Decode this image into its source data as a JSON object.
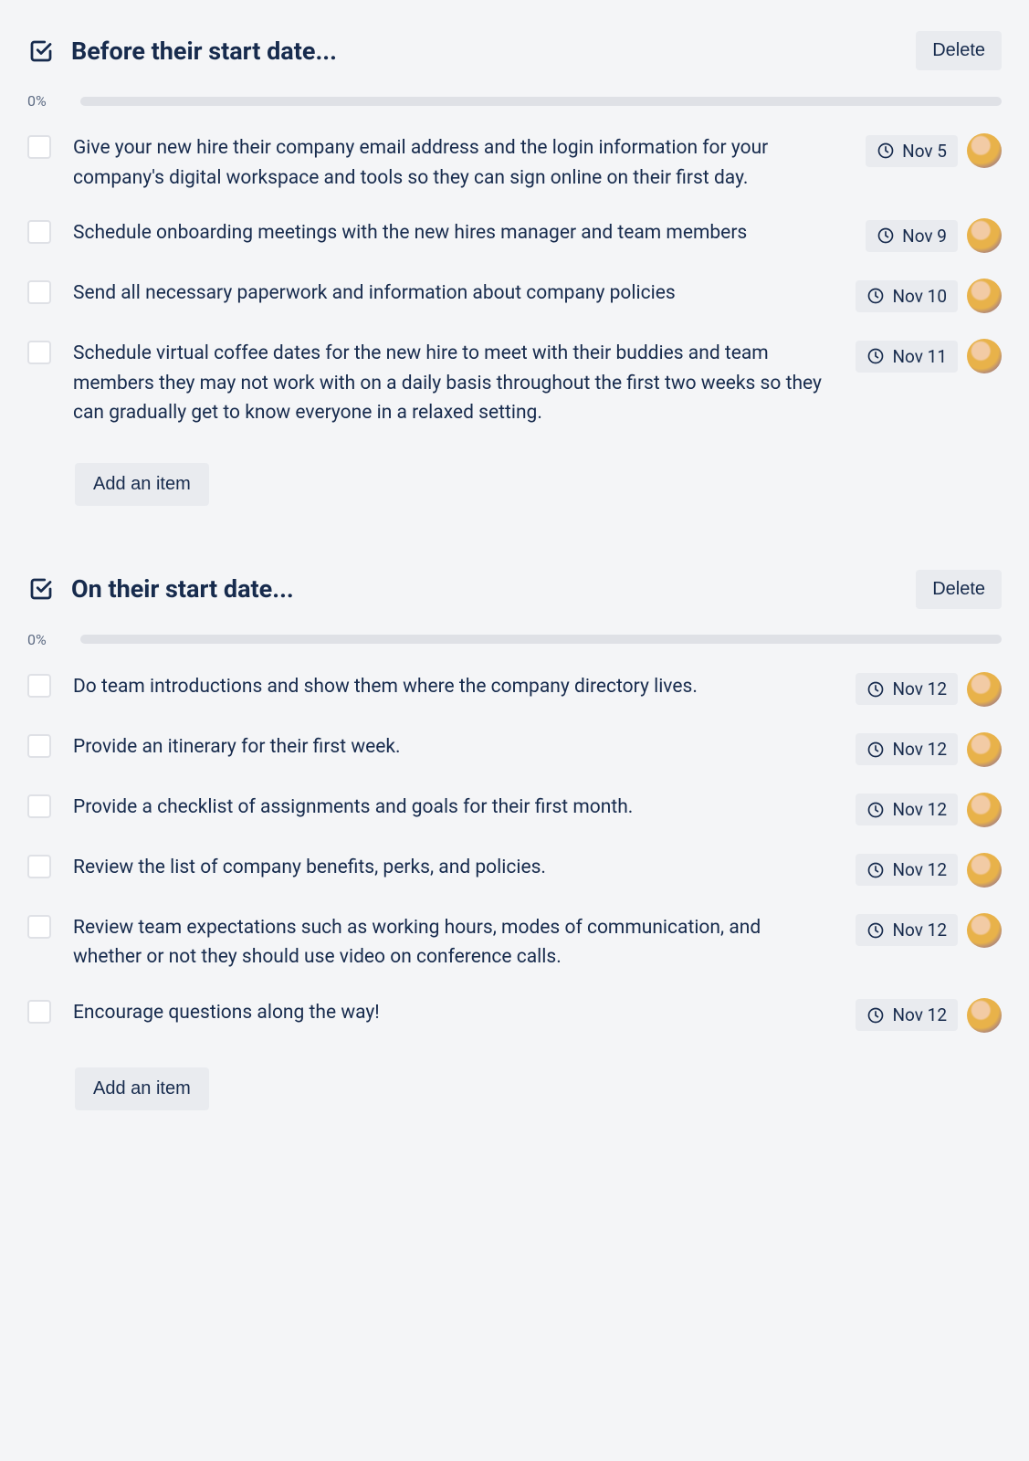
{
  "sections": [
    {
      "title": "Before their start date...",
      "delete_label": "Delete",
      "progress_pct": "0%",
      "add_item_label": "Add an item",
      "items": [
        {
          "text": "Give your new hire their company email address and the login information for your company's digital workspace and tools so they can sign online on their first day.",
          "date": "Nov 5"
        },
        {
          "text": "Schedule onboarding meetings with the new hires manager and team members",
          "date": "Nov 9"
        },
        {
          "text": "Send all necessary paperwork and information about company policies",
          "date": "Nov 10"
        },
        {
          "text": "Schedule virtual coffee dates for the new hire to meet with their buddies and team members they may not work with on a daily basis throughout the first two weeks so they can gradually get to know everyone in a relaxed setting.",
          "date": "Nov 11"
        }
      ]
    },
    {
      "title": "On their start date...",
      "delete_label": "Delete",
      "progress_pct": "0%",
      "add_item_label": "Add an item",
      "items": [
        {
          "text": "Do team introductions and show them where the company directory lives.",
          "date": "Nov 12"
        },
        {
          "text": "Provide an itinerary for their first week.",
          "date": "Nov 12"
        },
        {
          "text": "Provide a checklist of assignments and goals for their first month.",
          "date": "Nov 12"
        },
        {
          "text": "Review the list of company benefits, perks, and policies.",
          "date": "Nov 12"
        },
        {
          "text": "Review team expectations such as working hours, modes of communication, and whether or not they should use video on conference calls.",
          "date": "Nov 12"
        },
        {
          "text": "Encourage questions along the way!",
          "date": "Nov 12"
        }
      ]
    }
  ]
}
